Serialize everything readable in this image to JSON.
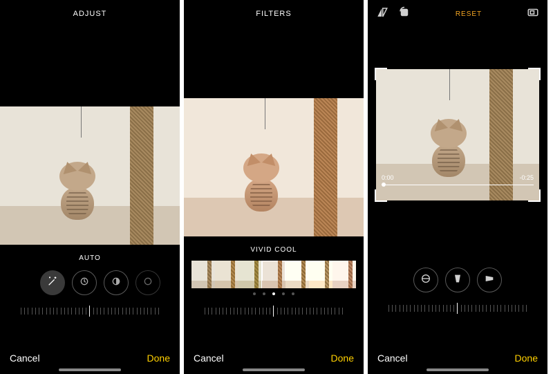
{
  "screen1": {
    "header_title": "ADJUST",
    "sub_label": "AUTO",
    "cancel": "Cancel",
    "done": "Done"
  },
  "screen2": {
    "header_title": "FILTERS",
    "sub_label": "VIVID COOL",
    "cancel": "Cancel",
    "done": "Done"
  },
  "screen3": {
    "reset_label": "RESET",
    "time_start": "0:00",
    "time_end": "-0:25",
    "cancel": "Cancel",
    "done": "Done"
  },
  "colors": {
    "accent": "#f5a623",
    "done": "#ffd000"
  }
}
